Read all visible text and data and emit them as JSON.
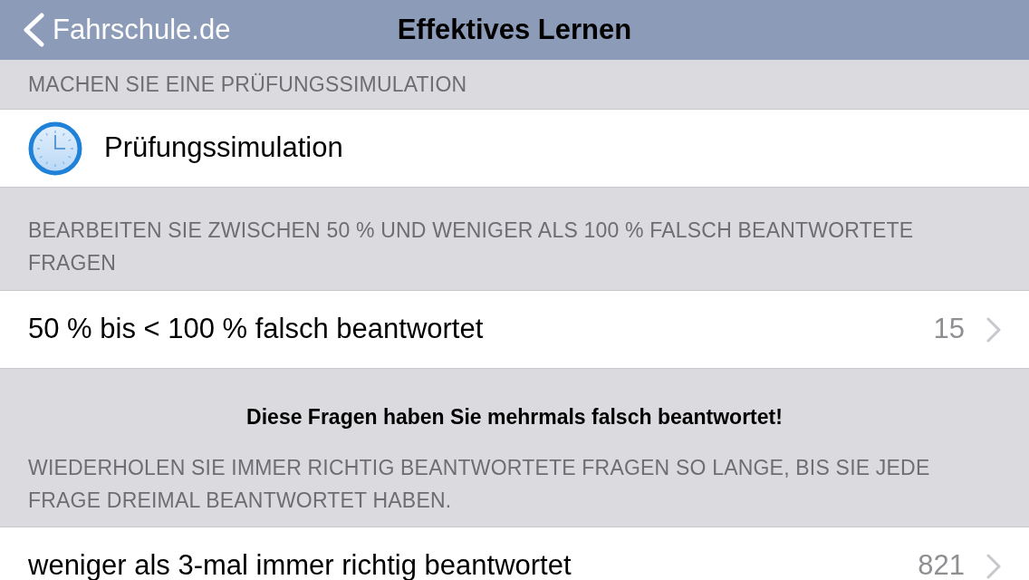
{
  "nav_bar": {
    "back_label": "Fahrschule.de",
    "title": "Effektives Lernen"
  },
  "sections": [
    {
      "header": "MACHEN SIE EINE PRÜFUNGSSIMULATION",
      "rows": [
        {
          "kind": "icon",
          "label": "Prüfungssimulation"
        }
      ]
    },
    {
      "header": "BEARBEITEN SIE ZWISCHEN 50 % UND WENIGER ALS 100 % FALSCH BEANTWORTETE FRAGEN",
      "rows": [
        {
          "kind": "count",
          "label": "50 % bis < 100 % falsch beantwortet",
          "count": "15"
        }
      ]
    },
    {
      "notice": "Diese Fragen haben Sie mehrmals falsch beantwortet!",
      "header": "WIEDERHOLEN SIE IMMER RICHTIG BEANTWORTETE FRAGEN SO LANGE, BIS SIE JEDE FRAGE DREIMAL BEANTWORTET HABEN.",
      "rows": [
        {
          "kind": "count",
          "label": "weniger als 3-mal immer richtig beantwortet",
          "count": "821"
        }
      ]
    }
  ]
}
